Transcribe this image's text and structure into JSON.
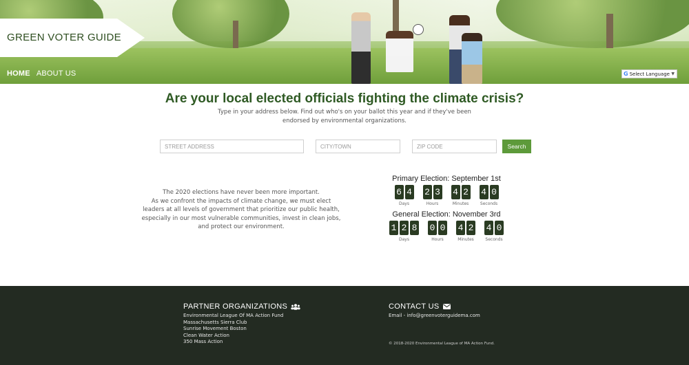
{
  "header": {
    "brand": "GREEN VOTER GUIDE",
    "nav": [
      {
        "label": "HOME",
        "active": true
      },
      {
        "label": "ABOUT US",
        "active": false
      }
    ],
    "language_selector": {
      "label": "Select Language",
      "icon": "google-g-icon"
    }
  },
  "main": {
    "headline": "Are your local elected officials fighting the climate crisis?",
    "subtext": "Type in your address below. Find out who's on your ballot this year and if they've been endorsed by environmental organizations.",
    "search": {
      "street_placeholder": "STREET ADDRESS",
      "city_placeholder": "CITY/TOWN",
      "zip_placeholder": "ZIP CODE",
      "button_label": "Search",
      "button_color": "#5d9a3a"
    },
    "intro_lines": [
      "The 2020 elections have never been more important.",
      "As we confront the impacts of climate change, we must elect",
      "leaders at all levels of government that prioritize our public health,",
      "especially in our most vulnerable communities, invest in clean jobs,",
      "and protect our environment."
    ],
    "countdowns": [
      {
        "title": "Primary Election: September 1st",
        "units": [
          {
            "value": "64",
            "label": "Days"
          },
          {
            "value": "23",
            "label": "Hours"
          },
          {
            "value": "42",
            "label": "Minutes"
          },
          {
            "value": "40",
            "label": "Seconds"
          }
        ]
      },
      {
        "title": "General Election: November 3rd",
        "units": [
          {
            "value": "128",
            "label": "Days"
          },
          {
            "value": "00",
            "label": "Hours"
          },
          {
            "value": "42",
            "label": "Minutes"
          },
          {
            "value": "40",
            "label": "Seconds"
          }
        ]
      }
    ]
  },
  "footer": {
    "partners_title": "PARTNER ORGANIZATIONS",
    "partners_icon": "users-icon",
    "partners": [
      "Environmental League Of MA Action Fund",
      "Massachusetts Sierra Club",
      "Sunrise Movement Boston",
      "Clean Water Action",
      "350 Mass Action"
    ],
    "contact_title": "CONTACT US",
    "contact_icon": "envelope-icon",
    "email": "Email - info@greenvoterguidema.com",
    "copyright": "© 2018-2020 Environmental League of MA Action Fund.",
    "background": "#232b22"
  }
}
